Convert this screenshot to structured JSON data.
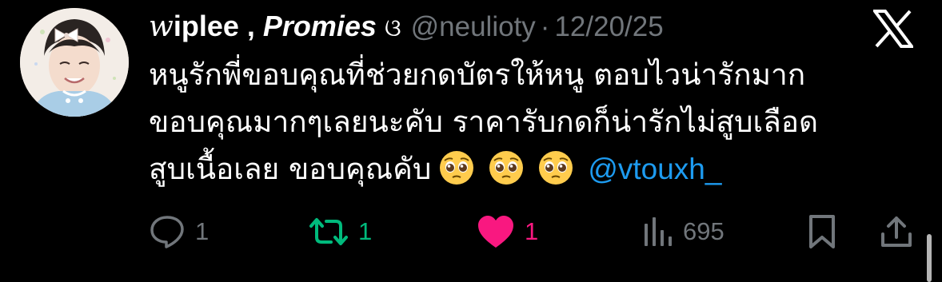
{
  "tweet": {
    "author": {
      "display_name_fancy_w": "w",
      "display_name_rest": "iplee , ",
      "display_name_italic": "Promies",
      "name_symbol": "ଓ",
      "handle": "@neulioty",
      "separator": "·",
      "date": "12/20/25"
    },
    "text_lines": [
      "หนูรักพี่ขอบคุณที่ช่วยกดบัตรให้หนู ตอบไวน่ารักมาก",
      "ขอบคุณมากๆเลยนะคับ ราคารับกดก็น่ารักไม่สูบเลือด",
      "สูบเนื้อเลย ขอบคุณคับ"
    ],
    "emoji": [
      "pleading-face",
      "pleading-face",
      "pleading-face"
    ],
    "mention": "@vtouxh_"
  },
  "actions": {
    "reply": {
      "icon": "reply-icon",
      "count": "1"
    },
    "retweet": {
      "icon": "retweet-icon",
      "count": "1",
      "color": "#00ba7c"
    },
    "like": {
      "icon": "heart-icon",
      "count": "1",
      "color": "#f91880"
    },
    "views": {
      "icon": "views-icon",
      "count": "695"
    },
    "bookmark": {
      "icon": "bookmark-icon"
    },
    "share": {
      "icon": "share-icon"
    }
  },
  "colors": {
    "background": "#000000",
    "text": "#ffffff",
    "muted": "#71767b",
    "link": "#1d9bf0"
  }
}
